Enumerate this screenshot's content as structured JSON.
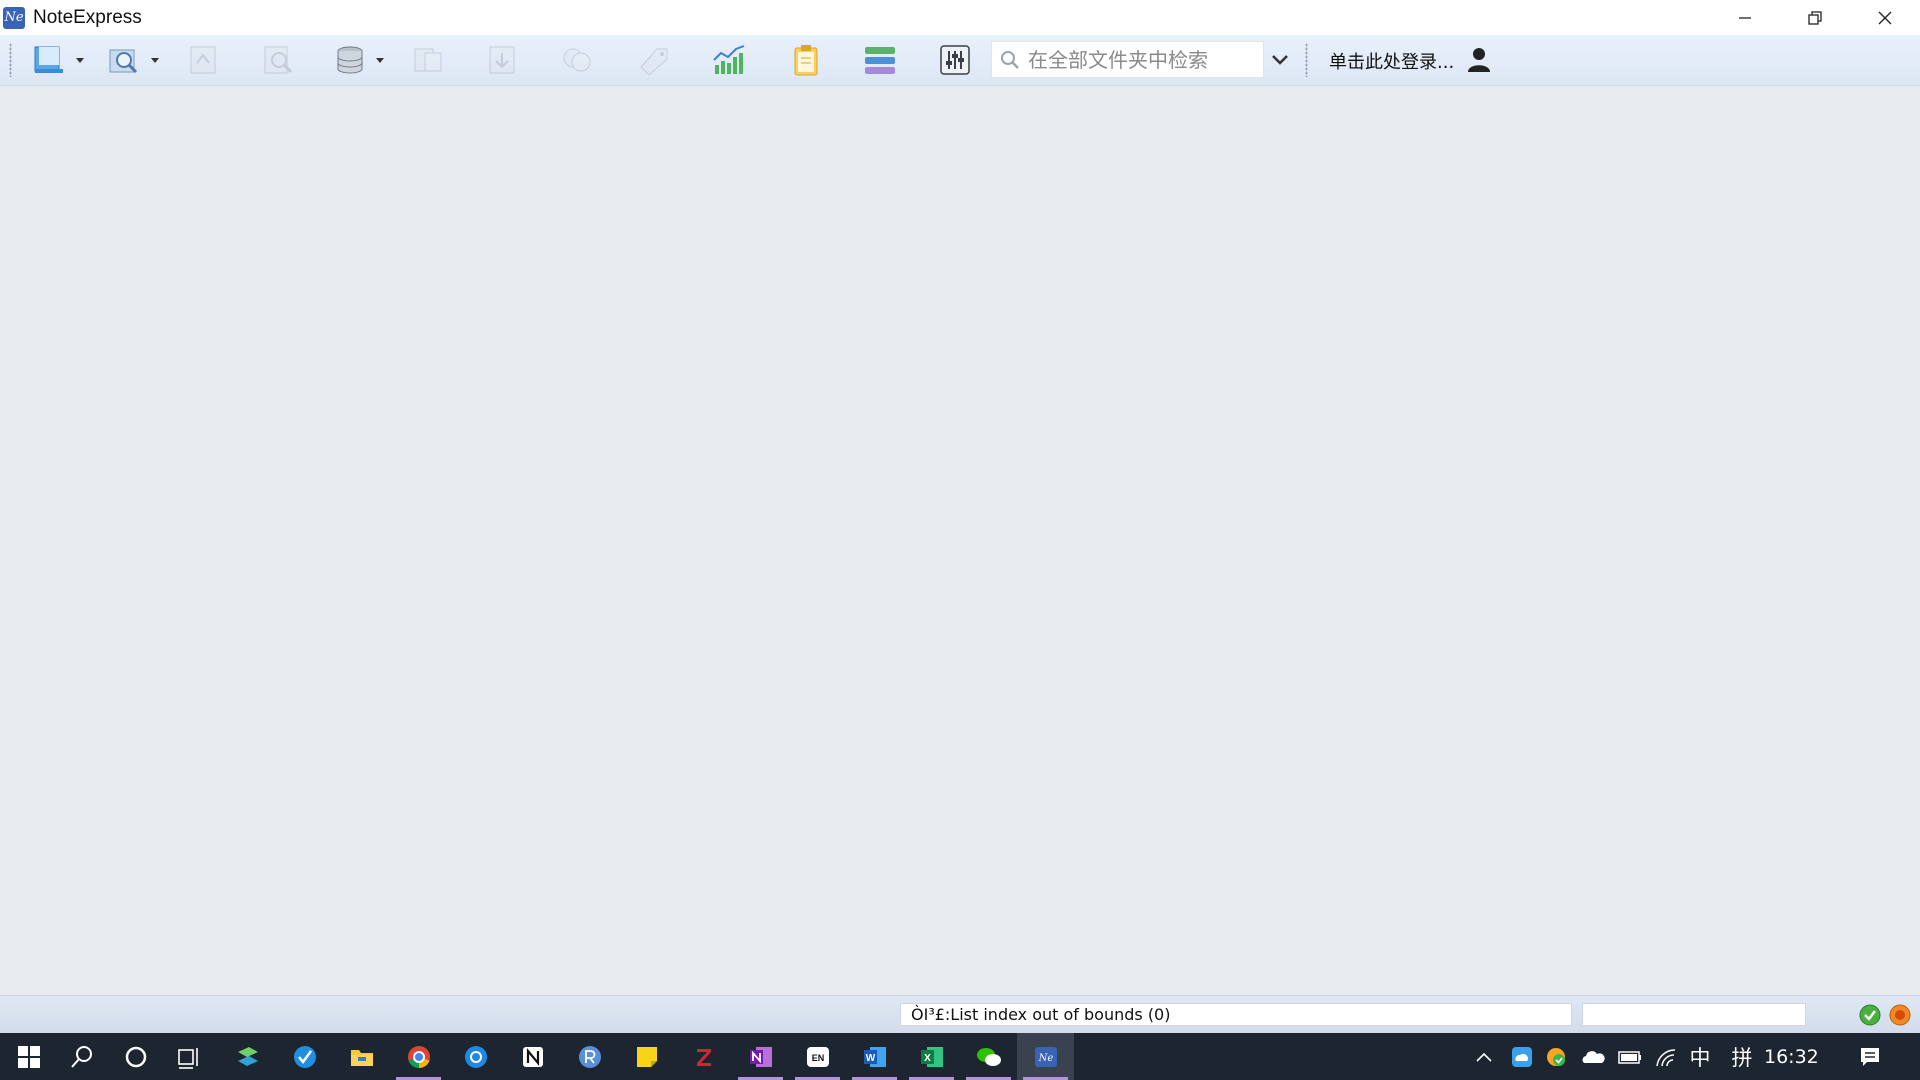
{
  "window": {
    "title": "NoteExpress",
    "logo_text": "Ne",
    "controls": {
      "minimize_icon": "minimize-icon",
      "restore_icon": "restore-icon",
      "close_icon": "close-icon"
    }
  },
  "toolbar": {
    "buttons": [
      {
        "name": "new-library",
        "icon": "library-icon",
        "has_dropdown": true,
        "enabled": true
      },
      {
        "name": "online-search",
        "icon": "online-search-icon",
        "has_dropdown": true,
        "enabled": true
      },
      {
        "name": "import-fulltext",
        "icon": "import-icon",
        "has_dropdown": false,
        "enabled": false
      },
      {
        "name": "find-fulltext",
        "icon": "find-fulltext-icon",
        "has_dropdown": false,
        "enabled": false
      },
      {
        "name": "database",
        "icon": "database-icon",
        "has_dropdown": true,
        "enabled": true
      },
      {
        "name": "smart-update",
        "icon": "update-icon",
        "has_dropdown": false,
        "enabled": false
      },
      {
        "name": "download-fulltext",
        "icon": "download-icon",
        "has_dropdown": false,
        "enabled": false
      },
      {
        "name": "find-duplicates",
        "icon": "duplicates-icon",
        "has_dropdown": false,
        "enabled": false
      },
      {
        "name": "tag",
        "icon": "tag-icon",
        "has_dropdown": false,
        "enabled": false
      },
      {
        "name": "analysis",
        "icon": "chart-icon",
        "has_dropdown": false,
        "enabled": true
      },
      {
        "name": "notes",
        "icon": "clipboard-icon",
        "has_dropdown": false,
        "enabled": true
      },
      {
        "name": "layout",
        "icon": "layout-icon",
        "has_dropdown": false,
        "enabled": true
      },
      {
        "name": "options",
        "icon": "settings-sliders-icon",
        "has_dropdown": false,
        "enabled": true
      }
    ],
    "search": {
      "placeholder": "在全部文件夹中检索",
      "value": ""
    },
    "login_label": "单击此处登录...",
    "user_icon": "user-icon"
  },
  "statusbar": {
    "message": "ÒI³£:List index out of bounds (0)",
    "secondary": "",
    "ok_icon": "check-circle-icon",
    "error_icon": "stop-circle-icon"
  },
  "taskbar": {
    "apps": [
      {
        "name": "start",
        "icon": "windows-start-icon",
        "active": false
      },
      {
        "name": "search",
        "icon": "search-icon",
        "active": false
      },
      {
        "name": "cortana",
        "icon": "cortana-icon",
        "active": false
      },
      {
        "name": "task-view",
        "icon": "task-view-icon",
        "active": false
      },
      {
        "name": "app-1",
        "icon": "arrow-app-icon",
        "active": false
      },
      {
        "name": "app-2",
        "icon": "check-app-icon",
        "active": false
      },
      {
        "name": "file-explorer",
        "icon": "folder-icon",
        "active": false
      },
      {
        "name": "chrome",
        "icon": "chrome-icon",
        "active": true
      },
      {
        "name": "mail",
        "icon": "mail-icon",
        "active": false
      },
      {
        "name": "notion",
        "icon": "notion-icon",
        "active": false
      },
      {
        "name": "r-app",
        "icon": "r-icon",
        "active": false
      },
      {
        "name": "sticky-notes",
        "icon": "sticky-notes-icon",
        "active": false
      },
      {
        "name": "zotero",
        "icon": "zotero-icon",
        "active": false
      },
      {
        "name": "onenote",
        "icon": "onenote-icon",
        "active": true
      },
      {
        "name": "dictionary",
        "icon": "en-dictionary-icon",
        "active": true
      },
      {
        "name": "word",
        "icon": "word-icon",
        "active": true
      },
      {
        "name": "excel",
        "icon": "excel-icon",
        "active": true
      },
      {
        "name": "wechat",
        "icon": "wechat-icon",
        "active": true
      },
      {
        "name": "noteexpress",
        "icon": "noteexpress-icon",
        "active": true,
        "focused": true
      }
    ],
    "tray": {
      "ime_mode": "中",
      "ime_layout": "拼",
      "time": "16:32"
    }
  },
  "colors": {
    "accent": "#3a62b5",
    "taskbar": "#1c2530",
    "content_bg": "#e8ecf0",
    "active_indicator": "#b592e0"
  }
}
